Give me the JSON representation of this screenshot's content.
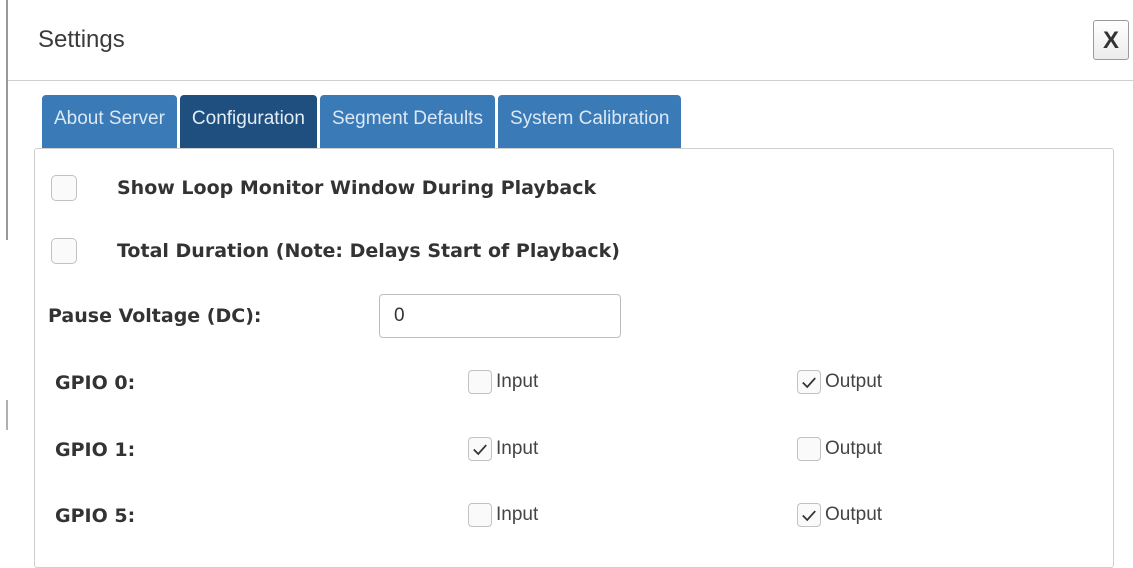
{
  "dialog": {
    "title": "Settings",
    "close_label": "X"
  },
  "tabs": [
    {
      "label": "About Server",
      "active": false
    },
    {
      "label": "Configuration",
      "active": true
    },
    {
      "label": "Segment Defaults",
      "active": false
    },
    {
      "label": "System Calibration",
      "active": false
    }
  ],
  "options": {
    "loop_monitor": {
      "label": "Show Loop Monitor Window During Playback",
      "checked": false
    },
    "total_duration": {
      "label": "Total Duration (Note: Delays Start of Playback)",
      "checked": false
    }
  },
  "pause_voltage": {
    "label": "Pause Voltage (DC):",
    "value": "0"
  },
  "gpio": [
    {
      "label": "GPIO 0:",
      "input_label": "Input",
      "input_checked": false,
      "output_label": "Output",
      "output_checked": true
    },
    {
      "label": "GPIO 1:",
      "input_label": "Input",
      "input_checked": true,
      "output_label": "Output",
      "output_checked": false
    },
    {
      "label": "GPIO 5:",
      "input_label": "Input",
      "input_checked": false,
      "output_label": "Output",
      "output_checked": true
    }
  ],
  "colors": {
    "tab": "#3a7ab7",
    "tab_active": "#1f4f7f"
  },
  "icons": {
    "check": "checkmark-icon",
    "close": "close-icon"
  }
}
